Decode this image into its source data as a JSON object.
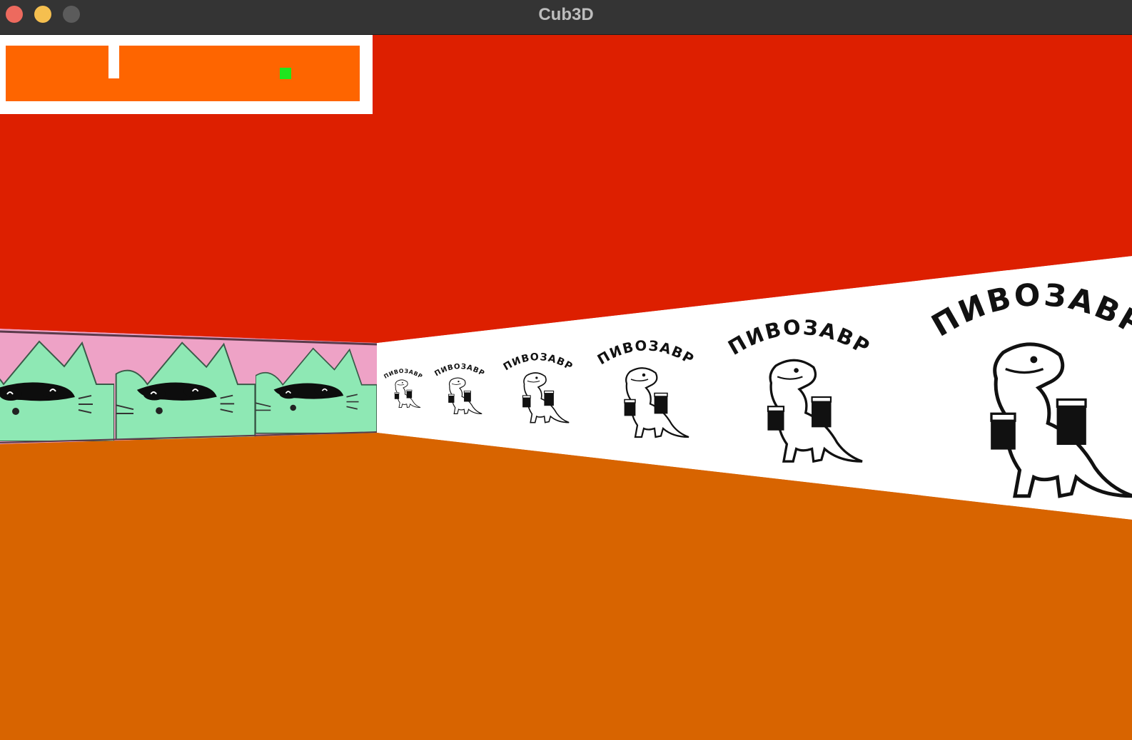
{
  "window": {
    "title": "Cub3D"
  },
  "scene": {
    "ceiling_color": "#dd1f00",
    "floor_color": "#d86400",
    "left_wall_texture": "cat-with-sunglasses",
    "right_wall_texture": "dinosaur-with-beer",
    "right_wall_label": "ПИВОЗАВР",
    "left_wall_colors": {
      "background": "#eea2c6",
      "cat": "#8ee8b4"
    }
  },
  "minimap": {
    "wall_color": "#ffffff",
    "floor_color": "#fe6500",
    "player_color": "#1ee61e"
  }
}
